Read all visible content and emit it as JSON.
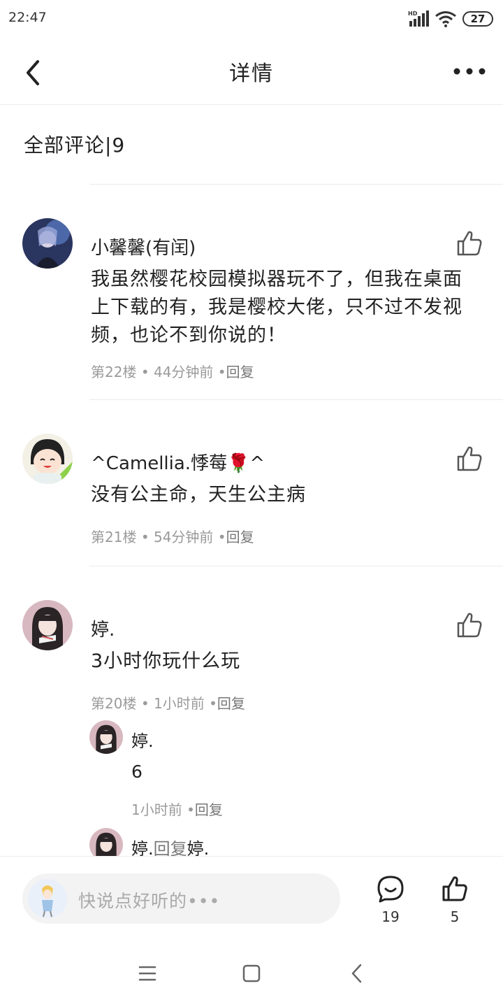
{
  "status_bar": {
    "time": "22:47",
    "network": "HD",
    "battery": "27",
    "icons": [
      "signal-icon",
      "wifi-icon",
      "battery-icon"
    ]
  },
  "header": {
    "title": "详情",
    "back_icon": "chevron-left-icon",
    "more_icon": "more-horizontal-icon"
  },
  "comments_header": "全部评论|9",
  "comments": [
    {
      "user": "小馨馨(有闰)",
      "content": "我虽然樱花校园模拟器玩不了，但我在桌面上下载的有，我是樱校大佬，只不过不发视频，也论不到你说的！",
      "floor": "第22楼",
      "time": "44分钟前",
      "reply_label": "回复"
    },
    {
      "user": "^Camellia.悸莓🌹^",
      "content": "没有公主命，天生公主病",
      "floor": "第21楼",
      "time": "54分钟前",
      "reply_label": "回复"
    },
    {
      "user": "婷.",
      "content": "3小时你玩什么玩",
      "floor": "第20楼",
      "time": "1小时前",
      "reply_label": "回复",
      "replies": [
        {
          "user": "婷.",
          "content": "6",
          "time": "1小时前",
          "reply_label": "回复"
        },
        {
          "user": "婷.",
          "reply_word": "回复",
          "target": "婷."
        }
      ]
    }
  ],
  "bottom_bar": {
    "placeholder": "快说点好听的•••",
    "comment_count": "19",
    "like_count": "5"
  },
  "nav_bar": {
    "icons": [
      "menu-icon",
      "home-square-icon",
      "back-triangle-icon"
    ]
  },
  "colors": {
    "text": "#222222",
    "meta": "#9a9a9a",
    "divider": "#ececec",
    "input_bg": "#f3f3f3"
  }
}
